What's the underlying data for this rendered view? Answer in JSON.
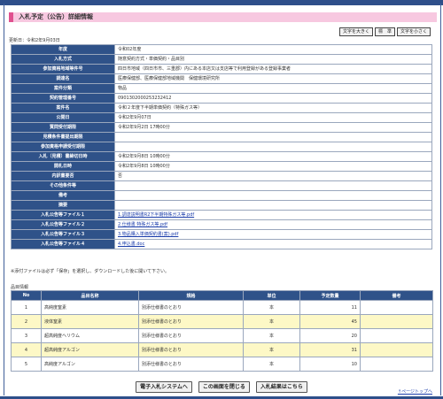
{
  "header": {
    "title": "入札予定（公告）詳細情報"
  },
  "font_buttons": [
    "文字を大きく",
    "標　準",
    "文字を小さく"
  ],
  "updated": "更新日：令和2年9月03日",
  "details": [
    {
      "label": "年度",
      "value": "令和02年度"
    },
    {
      "label": "入札方式",
      "value": "随意契約方式・単価契約・品目別"
    },
    {
      "label": "参加資格地域等件号",
      "value": "四日市地域（四日市市、三重郡）内にある本店又は支店等で利用登録がある登録事業者"
    },
    {
      "label": "調達名",
      "value": "医療保健部、医療保健部地域機関　保健環境研究所"
    },
    {
      "label": "案件分類",
      "value": "物品"
    },
    {
      "label": "契約管理番号",
      "value": "0901302000253232412"
    },
    {
      "label": "案件名",
      "value": "令和２年度下半期単価契約（特殊ガス等）"
    },
    {
      "label": "公開日",
      "value": "令和2年9月07日"
    },
    {
      "label": "質問受付期限",
      "value": "令和2年9月2日 17時00分"
    },
    {
      "label": "見積条件書提出期限",
      "value": ""
    },
    {
      "label": "参加資格申請受付期限",
      "value": ""
    },
    {
      "label": "入札（見積）書締切日時",
      "value": "令和2年9月8日 10時00分"
    },
    {
      "label": "開札日時",
      "value": "令和2年9月8日 10時00分"
    },
    {
      "label": "内訳書要否",
      "value": "否"
    },
    {
      "label": "その他条件等",
      "value": ""
    },
    {
      "label": "備考",
      "value": ""
    },
    {
      "label": "摘要",
      "value": ""
    },
    {
      "label": "入札公告等ファイル１",
      "value": "1.調達説明書R2下半期特殊ガス等.pdf",
      "link": true
    },
    {
      "label": "入札公告等ファイル２",
      "value": "2.仕様書 特殊ガス等.pdf",
      "link": true
    },
    {
      "label": "入札公告等ファイル３",
      "value": "3.物品購入単価契約書(案).pdf",
      "link": true
    },
    {
      "label": "入札公告等ファイル４",
      "value": "4.申込書.doc",
      "link": true
    }
  ],
  "note": "※添付ファイルは必ず「保存」を選択し、ダウンロードした後に開いて下さい。",
  "items_section": {
    "label": "品目情報",
    "headers": [
      "No",
      "品目名称",
      "規格",
      "単位",
      "予定数量",
      "備考"
    ],
    "rows": [
      {
        "no": "1",
        "name": "高純度窒素",
        "spec": "別添仕様書のとおり",
        "unit": "本",
        "qty": "11",
        "remark": ""
      },
      {
        "no": "2",
        "name": "液体窒素",
        "spec": "別添仕様書のとおり",
        "unit": "本",
        "qty": "45",
        "remark": ""
      },
      {
        "no": "3",
        "name": "超高純度ヘリウム",
        "spec": "別添仕様書のとおり",
        "unit": "本",
        "qty": "20",
        "remark": ""
      },
      {
        "no": "4",
        "name": "超高純度アルゴン",
        "spec": "別添仕様書のとおり",
        "unit": "本",
        "qty": "31",
        "remark": ""
      },
      {
        "no": "5",
        "name": "高純度アルゴン",
        "spec": "別添仕様書のとおり",
        "unit": "本",
        "qty": "10",
        "remark": ""
      }
    ]
  },
  "buttons": [
    "電子入札システムへ",
    "この画面を閉じる",
    "入札結果はこちら"
  ],
  "page_top": "↑ページトップへ"
}
